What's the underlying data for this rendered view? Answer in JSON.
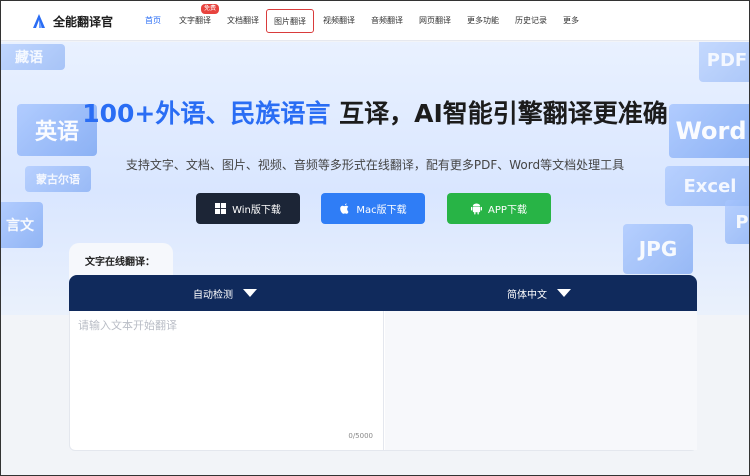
{
  "app": {
    "name": "全能翻译官"
  },
  "nav": {
    "items": [
      {
        "label": "首页"
      },
      {
        "label": "文字翻译",
        "badge": "免费"
      },
      {
        "label": "文档翻译"
      },
      {
        "label": "图片翻译"
      },
      {
        "label": "视频翻译"
      },
      {
        "label": "音频翻译"
      },
      {
        "label": "网页翻译"
      },
      {
        "label": "更多功能"
      },
      {
        "label": "历史记录"
      },
      {
        "label": "更多"
      }
    ],
    "active_index": 0,
    "highlighted_index": 3
  },
  "hero": {
    "title_highlight": "100+外语、民族语言",
    "title_rest": " 互译，AI智能引擎翻译更准确",
    "subtitle": "支持文字、文档、图片、视频、音频等多形式在线翻译，配有更多PDF、Word等文档处理工具",
    "decorations": [
      "英语",
      "藏语",
      "蒙古尔语",
      "言文",
      "PDF",
      "Word",
      "Excel",
      "JPG",
      "P"
    ],
    "buttons": [
      {
        "label": "Win版下载",
        "icon": "windows-icon",
        "color": "#1c2536"
      },
      {
        "label": "Mac版下载",
        "icon": "apple-icon",
        "color": "#2f7df6"
      },
      {
        "label": "APP下载",
        "icon": "android-icon",
        "color": "#28b446"
      }
    ]
  },
  "translator": {
    "section_label": "文字在线翻译：",
    "source_lang": "自动检测",
    "target_lang": "简体中文",
    "placeholder": "请输入文本开始翻译",
    "char_count": "0/5000"
  },
  "colors": {
    "accent": "#2a6df4",
    "lang_bar": "#102a5c",
    "badge": "#e8433e",
    "highlight_border": "#d93b3b"
  }
}
